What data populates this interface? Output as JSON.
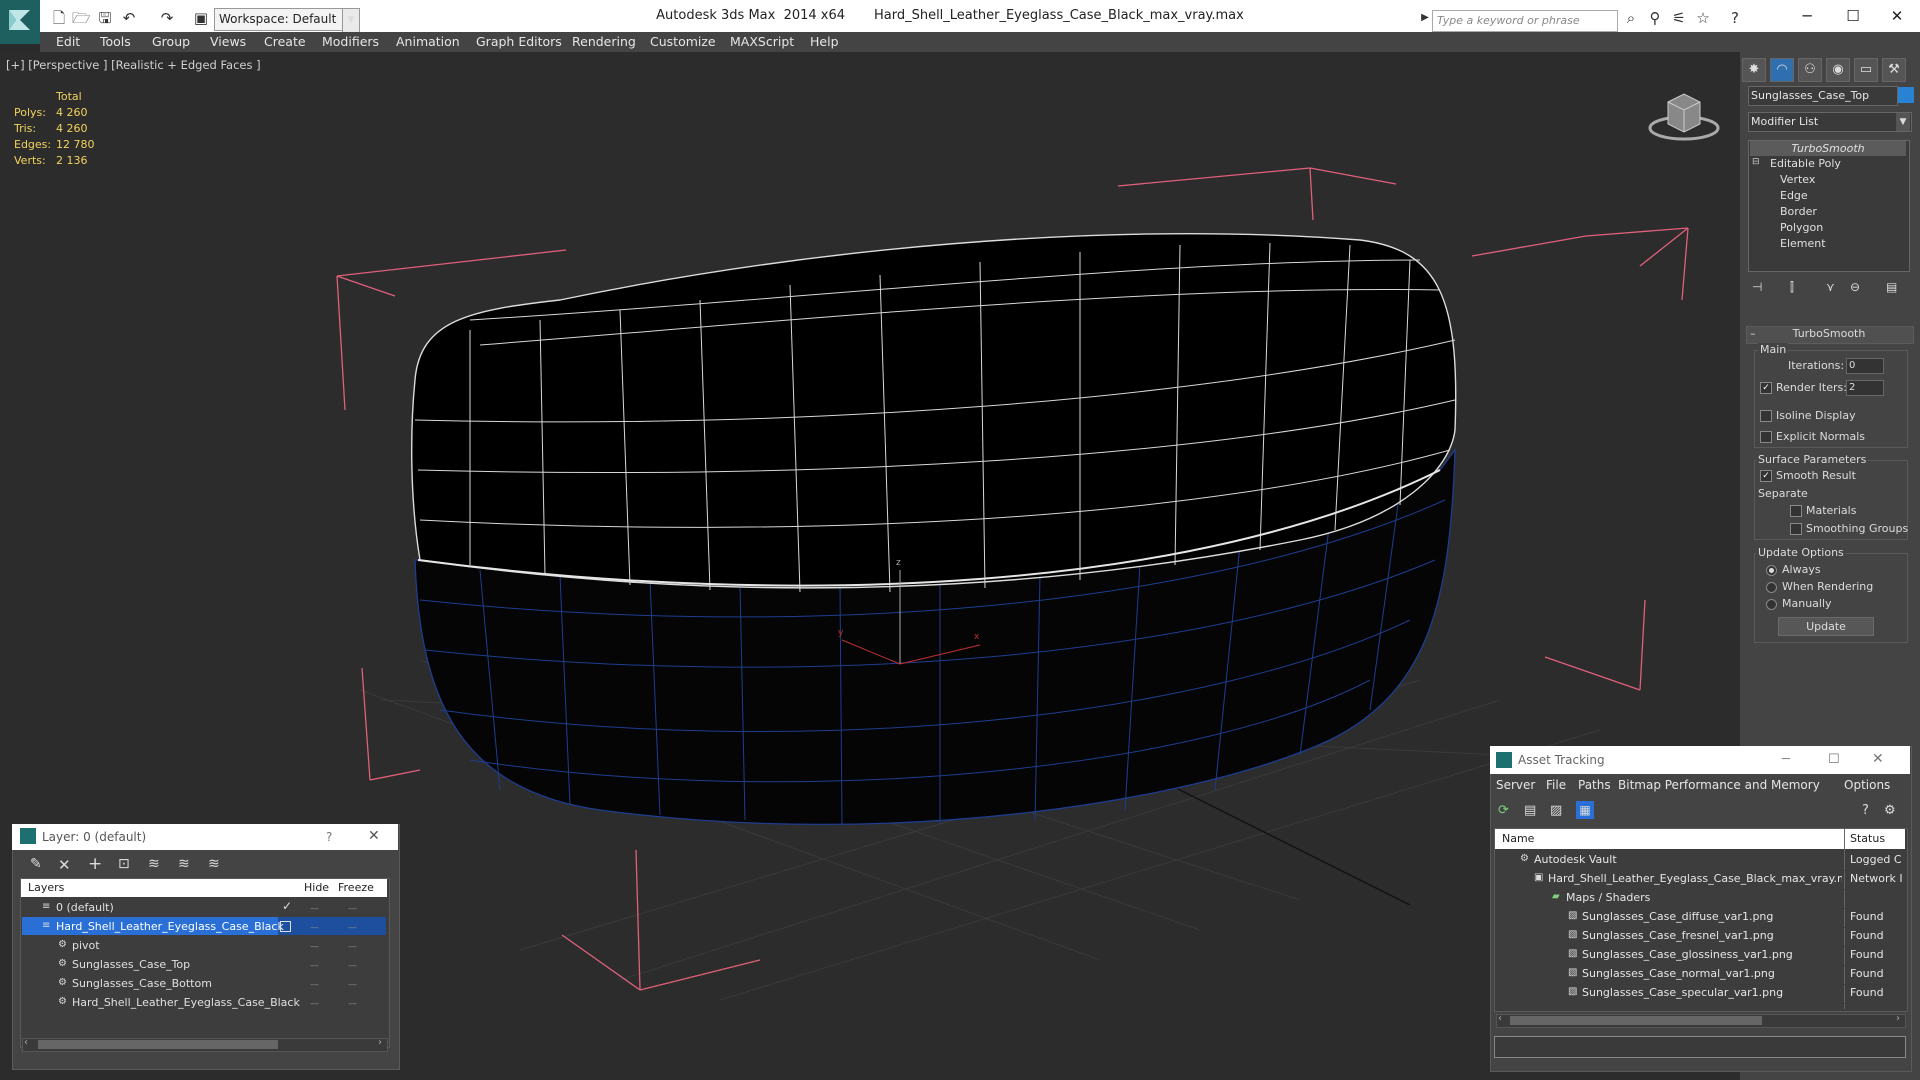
{
  "titlebar": {
    "workspace": "Workspace: Default",
    "title": "Autodesk 3ds Max  2014 x64       Hard_Shell_Leather_Eyeglass_Case_Black_max_vray.max",
    "search_placeholder": "Type a keyword or phrase"
  },
  "menu": [
    "Edit",
    "Tools",
    "Group",
    "Views",
    "Create",
    "Modifiers",
    "Animation",
    "Graph Editors",
    "Rendering",
    "Customize",
    "MAXScript",
    "Help"
  ],
  "viewport": {
    "label": "[+] [Perspective ] [Realistic + Edged Faces ]",
    "stats": {
      "header": "Total",
      "rows": [
        {
          "label": "Polys:",
          "value": "4 260"
        },
        {
          "label": "Tris:",
          "value": "4 260"
        },
        {
          "label": "Edges:",
          "value": "12 780"
        },
        {
          "label": "Verts:",
          "value": "2 136"
        }
      ]
    },
    "axis_labels": {
      "z": "z",
      "y": "y",
      "x": "x"
    }
  },
  "command_panel": {
    "object_name": "Sunglasses_Case_Top",
    "object_color": "#2a82d4",
    "modifier_list": "Modifier List",
    "stack": [
      {
        "label": "TurboSmooth",
        "level": 0,
        "italic": true
      },
      {
        "label": "Editable Poly",
        "level": 0
      },
      {
        "label": "Vertex",
        "level": 1
      },
      {
        "label": "Edge",
        "level": 1
      },
      {
        "label": "Border",
        "level": 1
      },
      {
        "label": "Polygon",
        "level": 1
      },
      {
        "label": "Element",
        "level": 1
      }
    ],
    "rollout_title": "TurboSmooth",
    "main_group": "Main",
    "iterations_label": "Iterations:",
    "iterations_value": "0",
    "render_iters_label": "Render Iters:",
    "render_iters_value": "2",
    "render_iters_checked": true,
    "isoline_label": "Isoline Display",
    "explicit_normals_label": "Explicit Normals",
    "surface_params_label": "Surface Parameters",
    "smooth_result_label": "Smooth Result",
    "smooth_result_checked": true,
    "separate_label": "Separate",
    "materials_label": "Materials",
    "smoothing_groups_label": "Smoothing Groups",
    "update_options_label": "Update Options",
    "update_options": [
      {
        "label": "Always",
        "selected": true
      },
      {
        "label": "When Rendering",
        "selected": false
      },
      {
        "label": "Manually",
        "selected": false
      }
    ],
    "update_button": "Update"
  },
  "layer_dialog": {
    "title": "Layer: 0 (default)",
    "help": "?",
    "columns": {
      "layers": "Layers",
      "hide": "Hide",
      "freeze": "Freeze"
    },
    "rows": [
      {
        "name": "0 (default)",
        "indent": 1,
        "selected": false,
        "checked": true
      },
      {
        "name": "Hard_Shell_Leather_Eyeglass_Case_Black",
        "indent": 1,
        "selected": true,
        "checked": false
      },
      {
        "name": "pivot",
        "indent": 2,
        "selected": false,
        "checked": false
      },
      {
        "name": "Sunglasses_Case_Top",
        "indent": 2,
        "selected": false,
        "checked": false
      },
      {
        "name": "Sunglasses_Case_Bottom",
        "indent": 2,
        "selected": false,
        "checked": false
      },
      {
        "name": "Hard_Shell_Leather_Eyeglass_Case_Black",
        "indent": 2,
        "selected": false,
        "checked": false
      }
    ]
  },
  "asset_dialog": {
    "title": "Asset Tracking",
    "menu": [
      "Server",
      "File",
      "Paths",
      "Bitmap Performance and Memory",
      "Options"
    ],
    "columns": {
      "name": "Name",
      "status": "Status"
    },
    "rows": [
      {
        "name": "Autodesk Vault",
        "status": "Logged C",
        "indent": 1
      },
      {
        "name": "Hard_Shell_Leather_Eyeglass_Case_Black_max_vray.max",
        "status": "Network I",
        "indent": 2
      },
      {
        "name": "Maps / Shaders",
        "status": "",
        "indent": 3
      },
      {
        "name": "Sunglasses_Case_diffuse_var1.png",
        "status": "Found",
        "indent": 4
      },
      {
        "name": "Sunglasses_Case_fresnel_var1.png",
        "status": "Found",
        "indent": 4
      },
      {
        "name": "Sunglasses_Case_glossiness_var1.png",
        "status": "Found",
        "indent": 4
      },
      {
        "name": "Sunglasses_Case_normal_var1.png",
        "status": "Found",
        "indent": 4
      },
      {
        "name": "Sunglasses_Case_specular_var1.png",
        "status": "Found",
        "indent": 4
      }
    ]
  }
}
